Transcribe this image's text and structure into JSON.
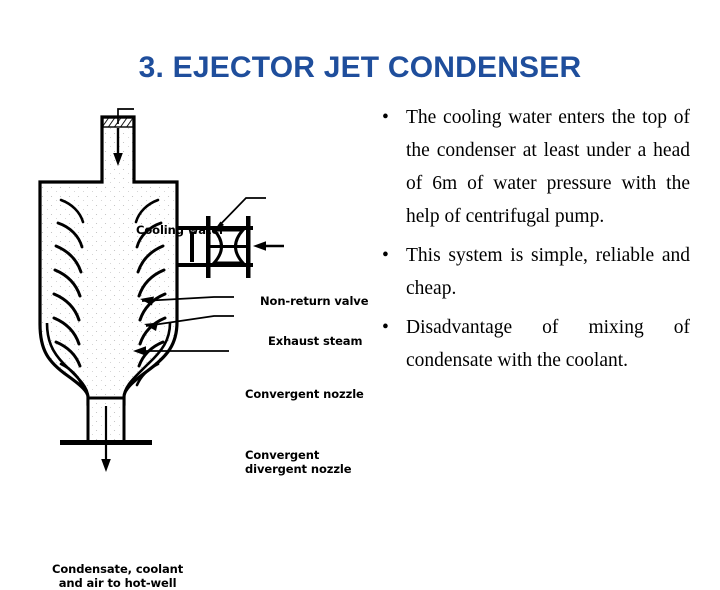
{
  "slide": {
    "title": "3. EJECTOR JET CONDENSER",
    "title_color": "#1F4E9C",
    "background_color": "#FFFFFF",
    "text_color": "#000000"
  },
  "bullets": [
    {
      "marker": "•",
      "text": "The cooling water enters the top of the condenser at least under a head of 6m of water pressure with the help of centrifugal pump."
    },
    {
      "marker": "•",
      "text": "This system is simple, reliable and cheap."
    },
    {
      "marker": "•",
      "text": "Disadvantage of mixing of condensate with the coolant."
    }
  ],
  "diagram": {
    "name": "ejector-jet-condenser-diagram",
    "labels": {
      "cooling_water": "Cooling water",
      "non_return_valve": "Non-return valve",
      "exhaust_steam": "Exhaust steam",
      "convergent_nozzle": "Convergent nozzle",
      "convergent_divergent_nozzle": "Convergent\ndivergent nozzle",
      "condensate_outlet": "Condensate, coolant\nand air to hot-well"
    }
  }
}
